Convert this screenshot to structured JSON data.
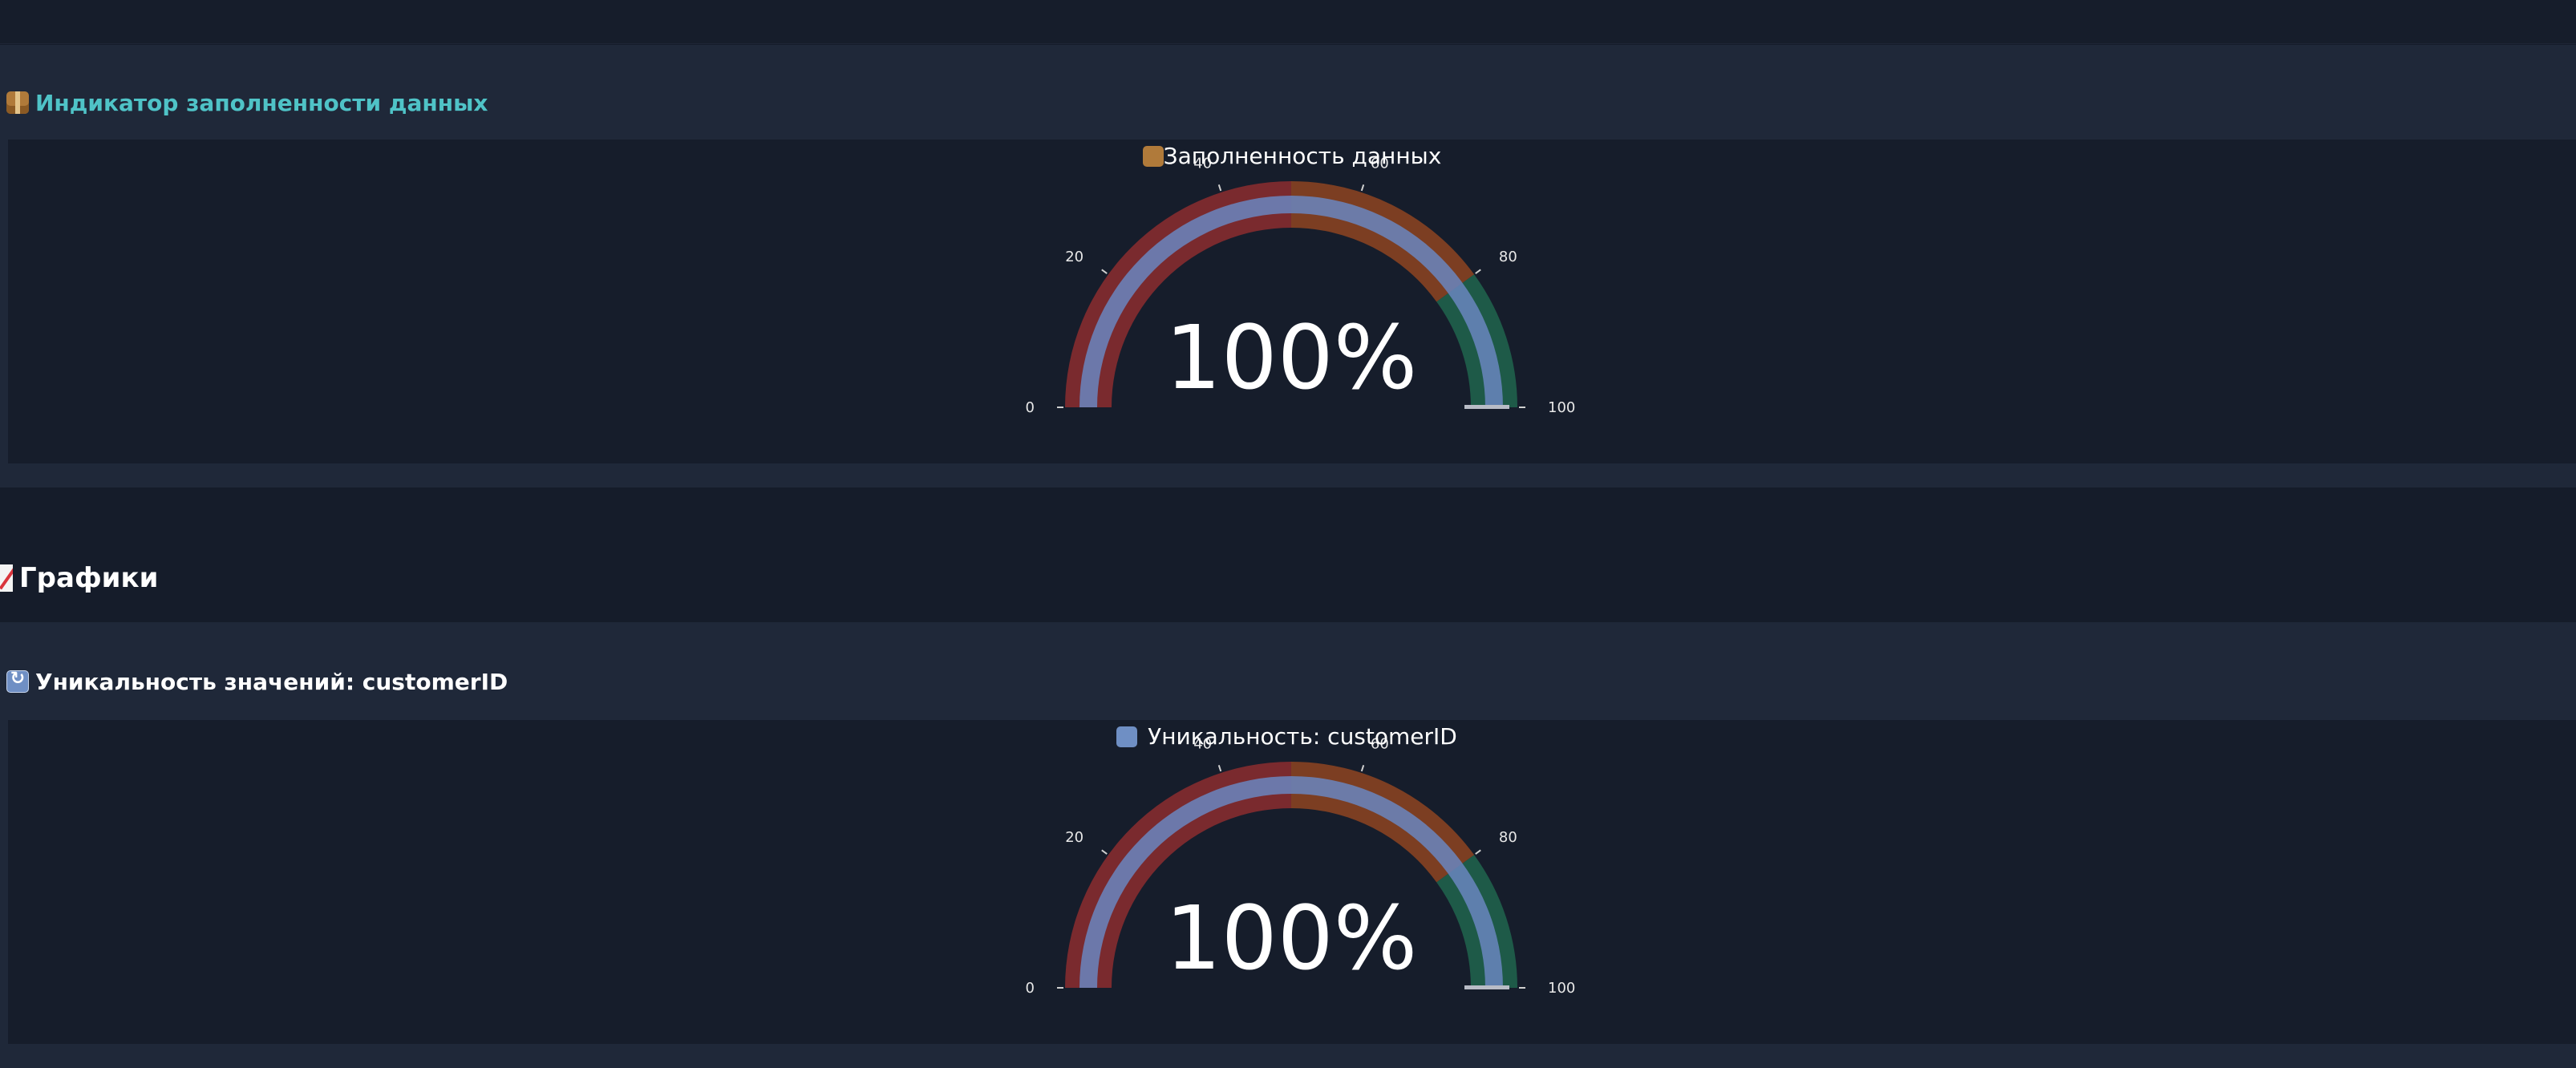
{
  "panels": [
    {
      "header": "Индикатор заполненности данных",
      "header_icon": "package-icon",
      "header_color": "#4fc3c7"
    },
    {
      "header": "Уникальность значений: customerID",
      "header_icon": "repeat-icon",
      "header_color": "#ffffff"
    }
  ],
  "section": {
    "title": "Графики",
    "icon": "chart-increasing-icon"
  },
  "colors": {
    "band_low": "#7a2a2e",
    "band_mid": "#7c3e22",
    "band_high": "#1e5a48",
    "bar": "#6a86c0",
    "bar_high": "#3f8fc0",
    "text": "#ffffff",
    "tick_text": "#e8e8e8"
  },
  "chart_data": [
    {
      "type": "gauge",
      "title": "Заполненность данных",
      "title_icon": "package-icon",
      "value": 100,
      "value_label": "100%",
      "range": [
        0,
        100
      ],
      "ticks": [
        0,
        20,
        40,
        60,
        80,
        100
      ],
      "tick_labels": [
        "0",
        "20",
        "40",
        "60",
        "80",
        "100"
      ],
      "steps": [
        {
          "range": [
            0,
            50
          ],
          "color": "#7a2a2e"
        },
        {
          "range": [
            50,
            80
          ],
          "color": "#7c3e22"
        },
        {
          "range": [
            80,
            100
          ],
          "color": "#1e5a48"
        }
      ],
      "threshold": 100
    },
    {
      "type": "gauge",
      "title": "Уникальность: customerID",
      "title_icon": "repeat-icon",
      "value": 100,
      "value_label": "100%",
      "range": [
        0,
        100
      ],
      "ticks": [
        0,
        20,
        40,
        60,
        80,
        100
      ],
      "tick_labels": [
        "0",
        "20",
        "40",
        "60",
        "80",
        "100"
      ],
      "steps": [
        {
          "range": [
            0,
            50
          ],
          "color": "#7a2a2e"
        },
        {
          "range": [
            50,
            80
          ],
          "color": "#7c3e22"
        },
        {
          "range": [
            80,
            100
          ],
          "color": "#1e5a48"
        }
      ],
      "threshold": 100
    }
  ]
}
